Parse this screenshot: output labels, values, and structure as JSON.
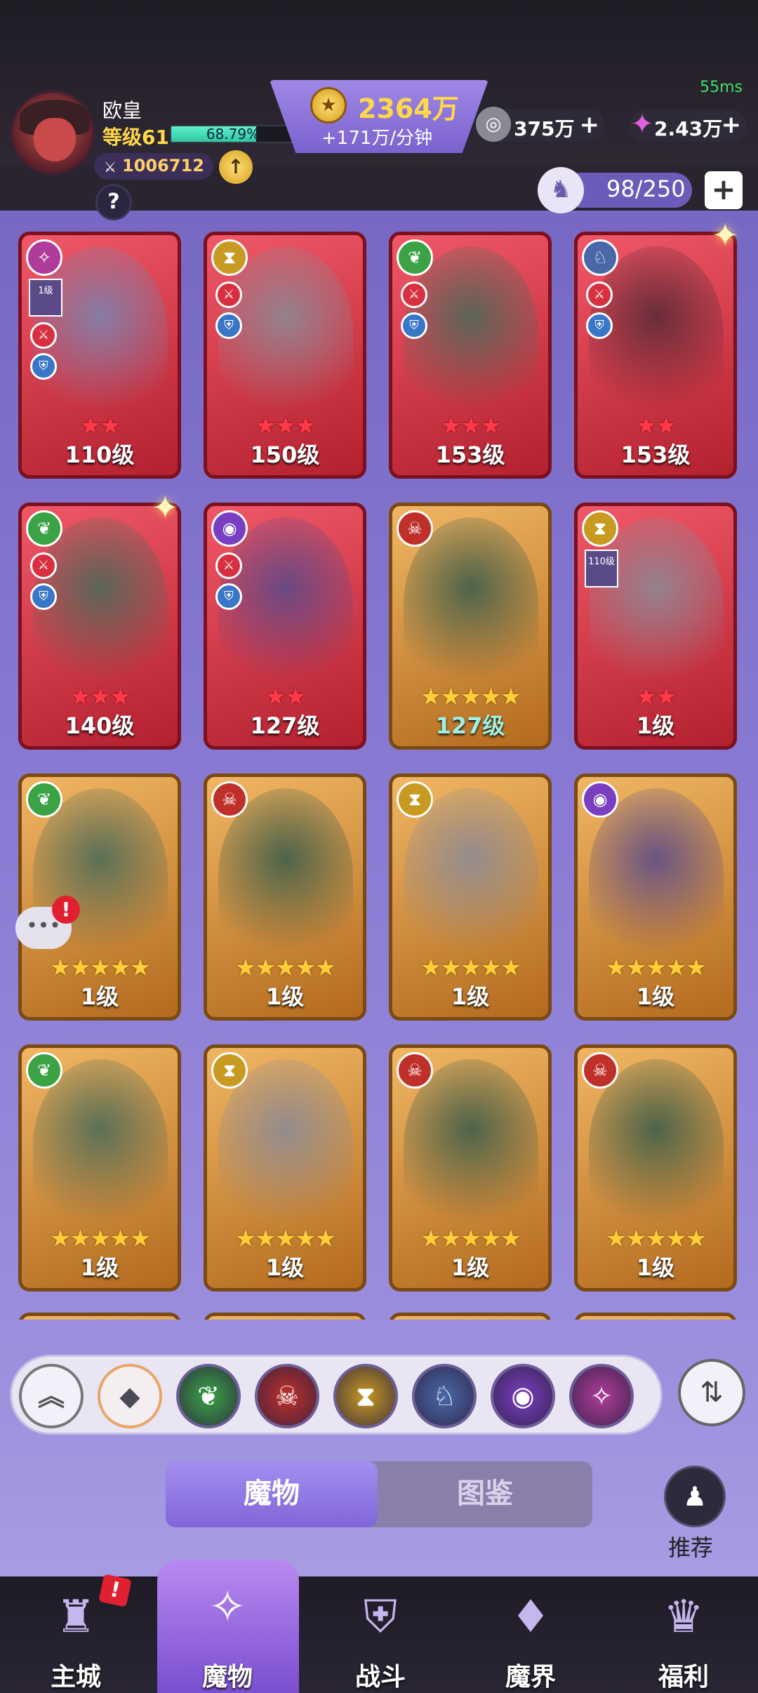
{
  "status": {
    "ping": "55ms"
  },
  "player": {
    "name": "欧皇",
    "level_label": "等级61",
    "xp_percent_text": "68.79%",
    "xp_fraction": 0.6879,
    "power": "1006712",
    "power_icon": "sword-icon",
    "upgrade_icon": "up-arrow-icon",
    "help_icon": "question-icon"
  },
  "currency": {
    "gold": "2364万",
    "gold_rate": "+171万/分钟",
    "silver": "375万",
    "gems": "2.43万",
    "plus": "+"
  },
  "roster": {
    "count": "98/250",
    "plus": "+"
  },
  "cards": [
    {
      "faction": "arcane",
      "frame": "red",
      "stars": 2,
      "star_color": "red",
      "level": "110级",
      "buffs": true,
      "mini": "1级",
      "color": "#b3202e"
    },
    {
      "faction": "time",
      "frame": "red",
      "stars": 3,
      "star_color": "red",
      "level": "150级",
      "buffs": true,
      "color": "#b3202e"
    },
    {
      "faction": "life",
      "frame": "red",
      "stars": 3,
      "star_color": "red",
      "level": "153级",
      "buffs": true,
      "color": "#b3202e"
    },
    {
      "faction": "dragon",
      "frame": "red",
      "stars": 2,
      "star_color": "red",
      "level": "153级",
      "buffs": true,
      "color": "#b3202e"
    },
    {
      "faction": "life",
      "frame": "red",
      "stars": 3,
      "star_color": "red",
      "level": "140级",
      "buffs": true,
      "color": "#b3202e"
    },
    {
      "faction": "eye",
      "frame": "red",
      "stars": 2,
      "star_color": "red",
      "level": "127级",
      "buffs": true,
      "color": "#b3202e"
    },
    {
      "faction": "demon",
      "frame": "gold",
      "stars": 5,
      "star_color": "gold",
      "level": "127级",
      "level_teal": true,
      "color": "#b36a1e"
    },
    {
      "faction": "time",
      "frame": "red",
      "stars": 2,
      "star_color": "red",
      "level": "1级",
      "mini": "110级",
      "color": "#b3202e"
    },
    {
      "faction": "life",
      "frame": "gold",
      "stars": 5,
      "star_color": "gold",
      "level": "1级",
      "color": "#b36a1e"
    },
    {
      "faction": "demon",
      "frame": "gold",
      "stars": 5,
      "star_color": "gold",
      "level": "1级",
      "color": "#b36a1e"
    },
    {
      "faction": "time",
      "frame": "gold",
      "stars": 5,
      "star_color": "gold",
      "level": "1级",
      "color": "#b36a1e"
    },
    {
      "faction": "eye",
      "frame": "gold",
      "stars": 5,
      "star_color": "gold",
      "level": "1级",
      "color": "#b36a1e"
    },
    {
      "faction": "life",
      "frame": "gold",
      "stars": 5,
      "star_color": "gold",
      "level": "1级",
      "color": "#b36a1e"
    },
    {
      "faction": "time",
      "frame": "gold",
      "stars": 5,
      "star_color": "gold",
      "level": "1级",
      "color": "#b36a1e"
    },
    {
      "faction": "demon",
      "frame": "gold",
      "stars": 5,
      "star_color": "gold",
      "level": "1级",
      "color": "#b36a1e"
    },
    {
      "faction": "demon",
      "frame": "gold",
      "stars": 5,
      "star_color": "gold",
      "level": "1级",
      "color": "#b36a1e"
    }
  ],
  "filters": [
    {
      "name": "collapse",
      "icon": "double-chevron-up-icon"
    },
    {
      "name": "all",
      "icon": "diamond-grid-icon"
    },
    {
      "name": "life",
      "icon": "leaf-icon"
    },
    {
      "name": "demon",
      "icon": "demon-mask-icon"
    },
    {
      "name": "time",
      "icon": "hourglass-icon"
    },
    {
      "name": "dragon",
      "icon": "dragon-icon"
    },
    {
      "name": "eye",
      "icon": "eye-icon"
    },
    {
      "name": "arcane",
      "icon": "arcane-star-icon"
    }
  ],
  "sort_icon": "sort-icon",
  "tabs": {
    "monsters": "魔物",
    "codex": "图鉴"
  },
  "recommend": {
    "label": "推荐",
    "icon": "people-icon"
  },
  "nav": {
    "main_city": "主城",
    "monsters": "魔物",
    "battle": "战斗",
    "demon_realm": "魔界",
    "welfare": "福利",
    "alert": "!"
  },
  "colors": {
    "gold_text": "#ffd84a",
    "xp_bar": "#2fc6a4",
    "active_tab": "#8066d8",
    "red_frame": "#b3202e",
    "gold_frame": "#b36a1e"
  }
}
